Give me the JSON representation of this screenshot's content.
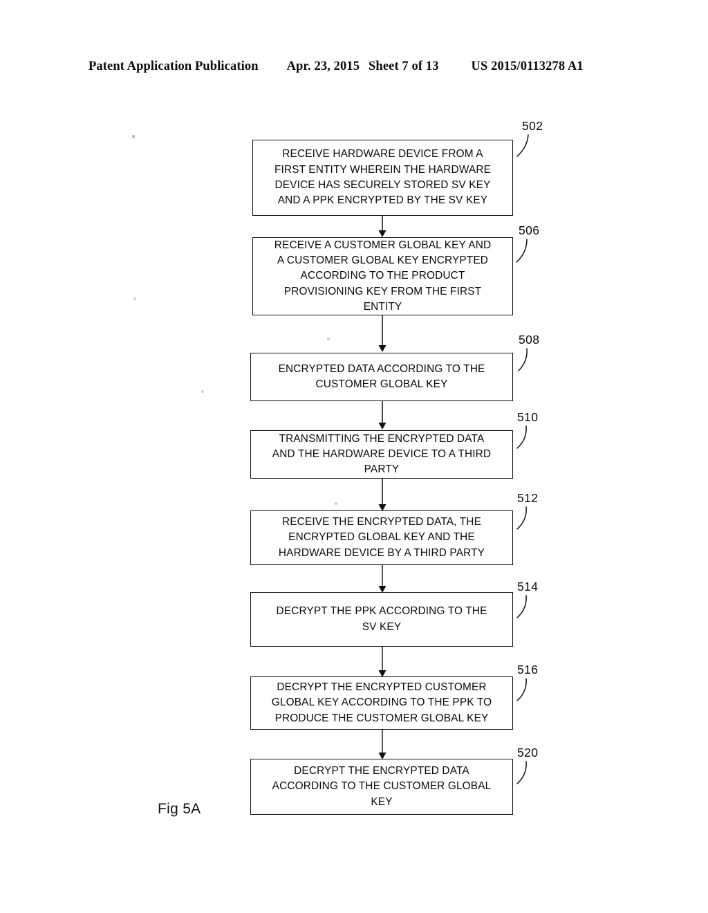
{
  "header": {
    "publication": "Patent Application Publication",
    "date": "Apr. 23, 2015",
    "sheet": "Sheet 7 of 13",
    "doc_number": "US 2015/0113278 A1"
  },
  "figure": {
    "caption": "Fig 5A",
    "ink_color": "#0a0a0a",
    "background_color": "#ffffff"
  },
  "flowchart": {
    "steps": [
      {
        "ref": "502",
        "text": "RECEIVE HARDWARE DEVICE FROM A\nFIRST ENTITY WHEREIN THE HARDWARE\nDEVICE HAS SECURELY STORED SV KEY\nAND A PPK ENCRYPTED BY THE SV KEY"
      },
      {
        "ref": "506",
        "text": "RECEIVE A CUSTOMER GLOBAL KEY AND\nA CUSTOMER GLOBAL KEY ENCRYPTED\nACCORDING TO THE PRODUCT\nPROVISIONING KEY FROM THE FIRST\nENTITY"
      },
      {
        "ref": "508",
        "text": "ENCRYPTED DATA ACCORDING TO THE\nCUSTOMER GLOBAL KEY"
      },
      {
        "ref": "510",
        "text": "TRANSMITTING THE ENCRYPTED DATA\nAND THE HARDWARE DEVICE TO A THIRD\nPARTY"
      },
      {
        "ref": "512",
        "text": "RECEIVE THE ENCRYPTED DATA, THE\nENCRYPTED GLOBAL KEY AND THE\nHARDWARE DEVICE BY A THIRD PARTY"
      },
      {
        "ref": "514",
        "text": "DECRYPT THE PPK ACCORDING TO THE\nSV KEY"
      },
      {
        "ref": "516",
        "text": "DECRYPT THE ENCRYPTED CUSTOMER\nGLOBAL KEY ACCORDING TO THE PPK TO\nPRODUCE THE CUSTOMER GLOBAL KEY"
      },
      {
        "ref": "520",
        "text": "DECRYPT THE ENCRYPTED DATA\nACCORDING TO THE CUSTOMER GLOBAL\nKEY"
      }
    ]
  }
}
